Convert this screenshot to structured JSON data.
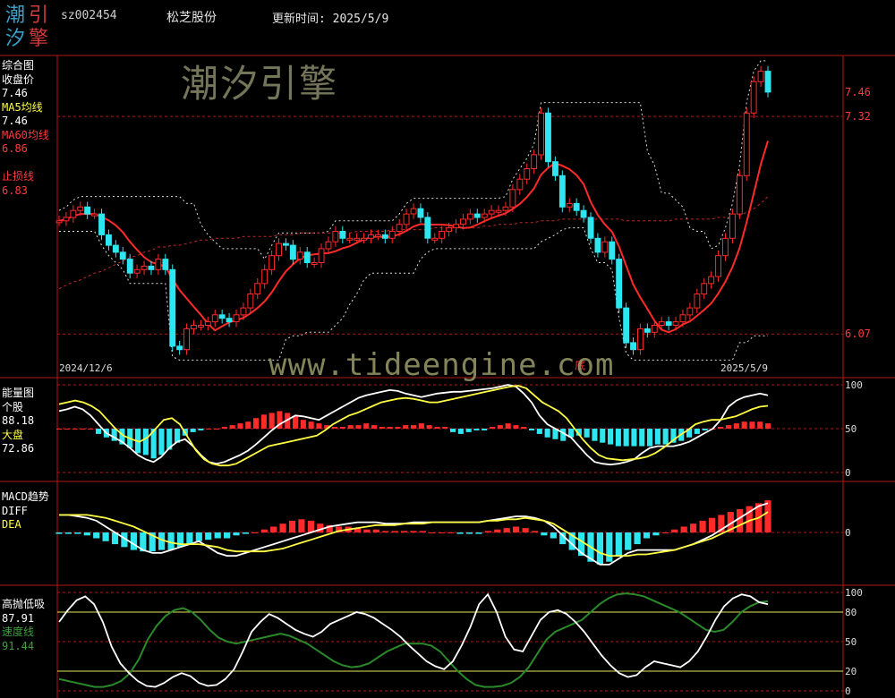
{
  "header": {
    "logo_chars": [
      "潮",
      "引",
      "汐",
      "擎"
    ],
    "code": "sz002454",
    "name": "松芝股份",
    "update": "更新时间: 2025/5/9"
  },
  "watermark": {
    "top": "潮汐引擎",
    "bottom": "www.tideengine.com"
  },
  "panels": {
    "main": {
      "labels": [
        {
          "text": "综合图",
          "color": "#ffffff"
        },
        {
          "text": "收盘价",
          "color": "#ffffff"
        },
        {
          "text": "7.46",
          "color": "#ffffff"
        },
        {
          "text": "MA5均线",
          "color": "#ffff44"
        },
        {
          "text": "7.46",
          "color": "#ffffff"
        },
        {
          "text": "MA60均线",
          "color": "#ff3b3b"
        },
        {
          "text": "6.86",
          "color": "#ff3b3b"
        },
        {
          "text": "",
          "color": "#ffffff"
        },
        {
          "text": "止损线",
          "color": "#ff3b3b"
        },
        {
          "text": "6.83",
          "color": "#ff3b3b"
        }
      ],
      "right_prices": [
        {
          "text": "7.46",
          "y": 7.46
        },
        {
          "text": "7.32",
          "y": 7.32
        },
        {
          "text": "6.07",
          "y": 6.07
        }
      ],
      "start_date": "2024/12/6",
      "end_date": "2025/5/9",
      "marker": "底"
    },
    "energy": {
      "labels": [
        {
          "text": "能量图",
          "color": "#ffffff"
        },
        {
          "text": "个股",
          "color": "#ffffff"
        },
        {
          "text": "88.18",
          "color": "#ffffff"
        },
        {
          "text": "大盘",
          "color": "#ffff44"
        },
        {
          "text": "72.86",
          "color": "#ffffff"
        }
      ],
      "axis": [
        "100",
        "50",
        "0"
      ]
    },
    "macd": {
      "labels": [
        {
          "text": "MACD趋势",
          "color": "#ffffff"
        },
        {
          "text": "DIFF",
          "color": "#ffffff"
        },
        {
          "text": "DEA",
          "color": "#ffff44"
        }
      ],
      "axis": [
        "0"
      ]
    },
    "osc": {
      "labels": [
        {
          "text": "高抛低吸",
          "color": "#ffffff"
        },
        {
          "text": "87.91",
          "color": "#ffffff"
        },
        {
          "text": "速度线",
          "color": "#3ca03c"
        },
        {
          "text": "91.44",
          "color": "#3ca03c"
        }
      ],
      "axis": [
        "100",
        "80",
        "50",
        "20",
        "0"
      ]
    }
  },
  "chart_data": [
    {
      "type": "candlestick",
      "ylim": [
        5.85,
        7.65
      ],
      "close": [
        6.72,
        6.74,
        6.78,
        6.8,
        6.76,
        6.76,
        6.64,
        6.58,
        6.54,
        6.5,
        6.42,
        6.44,
        6.46,
        6.44,
        6.5,
        6.44,
        6.0,
        5.98,
        6.1,
        6.12,
        6.12,
        6.14,
        6.18,
        6.16,
        6.14,
        6.18,
        6.22,
        6.3,
        6.36,
        6.44,
        6.52,
        6.59,
        6.58,
        6.5,
        6.54,
        6.48,
        6.48,
        6.56,
        6.6,
        6.66,
        6.62,
        6.62,
        6.62,
        6.62,
        6.64,
        6.64,
        6.62,
        6.66,
        6.7,
        6.76,
        6.79,
        6.74,
        6.62,
        6.62,
        6.66,
        6.68,
        6.7,
        6.73,
        6.76,
        6.74,
        6.76,
        6.78,
        6.78,
        6.8,
        6.9,
        6.96,
        7.02,
        7.1,
        7.34,
        7.06,
        6.98,
        6.8,
        6.82,
        6.78,
        6.74,
        6.62,
        6.54,
        6.6,
        6.5,
        6.22,
        6.02,
        5.98,
        6.1,
        6.08,
        6.12,
        6.14,
        6.12,
        6.14,
        6.18,
        6.22,
        6.3,
        6.36,
        6.4,
        6.52,
        6.62,
        6.76,
        6.98,
        7.34,
        7.52,
        7.58,
        7.46
      ],
      "ma60": [
        6.33,
        6.35,
        6.37,
        6.38,
        6.4,
        6.42,
        6.43,
        6.45,
        6.47,
        6.49,
        6.51,
        6.52,
        6.54,
        6.55,
        6.57,
        6.57,
        6.58,
        6.58,
        6.59,
        6.6,
        6.61,
        6.61,
        6.62,
        6.62,
        6.62,
        6.62,
        6.63,
        6.63,
        6.63,
        6.63,
        6.63,
        6.64,
        6.64,
        6.64,
        6.65,
        6.65,
        6.65,
        6.65,
        6.65,
        6.65,
        6.65,
        6.65,
        6.66,
        6.66,
        6.66,
        6.66,
        6.66,
        6.67,
        6.67,
        6.67,
        6.67,
        6.67,
        6.67,
        6.68,
        6.68,
        6.68,
        6.68,
        6.68,
        6.68,
        6.68,
        6.69,
        6.69,
        6.7,
        6.7,
        6.7,
        6.71,
        6.71,
        6.71,
        6.72,
        6.72,
        6.72,
        6.73,
        6.73,
        6.73,
        6.73,
        6.73,
        6.73,
        6.73,
        6.73,
        6.73,
        6.72,
        6.72,
        6.72,
        6.72,
        6.72,
        6.72,
        6.72,
        6.73,
        6.73,
        6.73,
        6.73,
        6.73,
        6.73,
        6.74,
        6.74,
        6.74,
        6.75,
        6.77,
        6.79,
        6.82,
        6.86
      ]
    },
    {
      "type": "line",
      "ylim": [
        0,
        100
      ],
      "series": [
        {
          "name": "个股",
          "values": [
            70,
            72,
            75,
            72,
            65,
            55,
            45,
            40,
            35,
            28,
            20,
            15,
            12,
            18,
            28,
            35,
            38,
            30,
            20,
            12,
            10,
            12,
            16,
            20,
            25,
            32,
            40,
            48,
            55,
            60,
            65,
            64,
            62,
            60,
            65,
            70,
            75,
            80,
            85,
            88,
            90,
            92,
            94,
            93,
            90,
            88,
            86,
            88,
            90,
            91,
            92,
            92,
            93,
            94,
            95,
            96,
            98,
            100,
            98,
            90,
            80,
            65,
            55,
            50,
            45,
            40,
            30,
            20,
            12,
            10,
            9,
            10,
            12,
            15,
            22,
            28,
            30,
            30,
            30,
            32,
            35,
            40,
            45,
            50,
            60,
            75,
            82,
            86,
            88,
            90,
            88
          ]
        },
        {
          "name": "大盘",
          "values": [
            78,
            80,
            82,
            80,
            76,
            70,
            60,
            50,
            42,
            38,
            35,
            40,
            50,
            60,
            62,
            55,
            40,
            25,
            15,
            10,
            8,
            8,
            10,
            15,
            20,
            25,
            30,
            32,
            34,
            36,
            38,
            40,
            42,
            48,
            55,
            60,
            65,
            68,
            72,
            76,
            80,
            82,
            84,
            85,
            84,
            82,
            80,
            80,
            82,
            84,
            86,
            88,
            90,
            92,
            94,
            96,
            98,
            99,
            96,
            88,
            80,
            75,
            70,
            62,
            50,
            38,
            28,
            20,
            16,
            15,
            14,
            15,
            16,
            18,
            22,
            28,
            35,
            42,
            48,
            55,
            58,
            60,
            60,
            62,
            64,
            68,
            72,
            75,
            76
          ]
        }
      ],
      "bars": [
        0,
        0,
        0,
        0,
        0,
        -6,
        -10,
        -14,
        -18,
        -22,
        -28,
        -30,
        -34,
        -30,
        -24,
        -16,
        -8,
        -4,
        -2,
        0,
        0,
        2,
        4,
        6,
        8,
        12,
        16,
        18,
        20,
        18,
        14,
        10,
        8,
        6,
        4,
        2,
        2,
        4,
        4,
        6,
        4,
        2,
        2,
        2,
        4,
        4,
        6,
        4,
        2,
        2,
        -4,
        -6,
        -4,
        -2,
        -2,
        2,
        4,
        6,
        4,
        2,
        -2,
        -6,
        -10,
        -12,
        -14,
        -10,
        -8,
        -10,
        -14,
        -16,
        -18,
        -20,
        -20,
        -20,
        -20,
        -20,
        -18,
        -18,
        -16,
        -14,
        -10,
        -6,
        -2,
        0,
        2,
        4,
        6,
        8,
        8,
        8,
        6
      ]
    },
    {
      "type": "line",
      "ylim": [
        -0.3,
        0.3
      ],
      "series": [
        {
          "name": "DIFF",
          "values": [
            0.12,
            0.12,
            0.11,
            0.1,
            0.08,
            0.04,
            0.0,
            -0.04,
            -0.08,
            -0.12,
            -0.14,
            -0.14,
            -0.12,
            -0.1,
            -0.08,
            -0.06,
            -0.1,
            -0.14,
            -0.16,
            -0.16,
            -0.14,
            -0.12,
            -0.1,
            -0.08,
            -0.06,
            -0.04,
            -0.02,
            0.0,
            0.02,
            0.04,
            0.05,
            0.06,
            0.07,
            0.07,
            0.07,
            0.06,
            0.06,
            0.06,
            0.07,
            0.07,
            0.07,
            0.07,
            0.07,
            0.07,
            0.07,
            0.07,
            0.08,
            0.09,
            0.1,
            0.11,
            0.11,
            0.1,
            0.08,
            0.04,
            -0.02,
            -0.08,
            -0.14,
            -0.18,
            -0.22,
            -0.22,
            -0.18,
            -0.14,
            -0.12,
            -0.12,
            -0.12,
            -0.12,
            -0.12,
            -0.1,
            -0.08,
            -0.05,
            -0.02,
            0.02,
            0.06,
            0.1,
            0.14,
            0.18,
            0.2
          ]
        },
        {
          "name": "DEA",
          "values": [
            0.12,
            0.12,
            0.12,
            0.12,
            0.11,
            0.1,
            0.08,
            0.06,
            0.04,
            0.01,
            -0.02,
            -0.05,
            -0.07,
            -0.08,
            -0.08,
            -0.08,
            -0.09,
            -0.1,
            -0.12,
            -0.13,
            -0.13,
            -0.13,
            -0.13,
            -0.12,
            -0.11,
            -0.09,
            -0.07,
            -0.05,
            -0.03,
            -0.01,
            0.01,
            0.02,
            0.03,
            0.04,
            0.05,
            0.05,
            0.05,
            0.06,
            0.06,
            0.06,
            0.07,
            0.07,
            0.07,
            0.07,
            0.07,
            0.07,
            0.08,
            0.08,
            0.09,
            0.09,
            0.1,
            0.09,
            0.08,
            0.06,
            0.02,
            -0.02,
            -0.06,
            -0.1,
            -0.14,
            -0.16,
            -0.16,
            -0.16,
            -0.15,
            -0.15,
            -0.14,
            -0.13,
            -0.12,
            -0.1,
            -0.08,
            -0.06,
            -0.04,
            -0.01,
            0.02,
            0.05,
            0.08,
            0.1,
            0.14
          ]
        }
      ],
      "bars": [
        -0.01,
        -0.01,
        -0.01,
        -0.02,
        -0.04,
        -0.06,
        -0.08,
        -0.1,
        -0.12,
        -0.13,
        -0.13,
        -0.12,
        -0.12,
        -0.1,
        -0.08,
        -0.06,
        -0.05,
        -0.04,
        -0.04,
        -0.02,
        -0.01,
        0.0,
        0.02,
        0.04,
        0.06,
        0.08,
        0.09,
        0.08,
        0.06,
        0.05,
        0.04,
        0.04,
        0.03,
        0.02,
        0.02,
        0.01,
        0.01,
        0.01,
        0.01,
        0.01,
        0.0,
        0.0,
        0.0,
        -0.01,
        -0.01,
        -0.01,
        0.01,
        0.02,
        0.03,
        0.04,
        0.03,
        0.01,
        -0.02,
        -0.04,
        -0.08,
        -0.12,
        -0.16,
        -0.2,
        -0.22,
        -0.2,
        -0.16,
        -0.12,
        -0.08,
        -0.04,
        -0.02,
        0.0,
        0.02,
        0.04,
        0.06,
        0.08,
        0.1,
        0.12,
        0.14,
        0.16,
        0.18,
        0.2,
        0.22
      ]
    },
    {
      "type": "line",
      "ylim": [
        0,
        100
      ],
      "series": [
        {
          "name": "高抛低吸",
          "values": [
            70,
            82,
            92,
            96,
            88,
            70,
            45,
            28,
            18,
            10,
            5,
            4,
            8,
            14,
            18,
            15,
            8,
            5,
            6,
            12,
            22,
            40,
            60,
            70,
            78,
            74,
            68,
            62,
            58,
            55,
            60,
            68,
            72,
            76,
            80,
            78,
            74,
            68,
            62,
            55,
            46,
            38,
            30,
            25,
            22,
            30,
            46,
            65,
            88,
            98,
            80,
            55,
            42,
            40,
            56,
            72,
            80,
            82,
            78,
            70,
            60,
            48,
            36,
            26,
            18,
            14,
            16,
            24,
            30,
            28,
            26,
            24,
            30,
            40,
            55,
            72,
            86,
            94,
            98,
            96,
            90,
            88
          ]
        },
        {
          "name": "速度线",
          "values": [
            12,
            10,
            8,
            6,
            4,
            4,
            6,
            10,
            18,
            32,
            52,
            66,
            76,
            82,
            84,
            80,
            72,
            62,
            54,
            50,
            48,
            50,
            52,
            54,
            56,
            58,
            56,
            52,
            48,
            42,
            36,
            30,
            26,
            24,
            25,
            28,
            34,
            40,
            44,
            48,
            48,
            48,
            46,
            40,
            30,
            20,
            12,
            6,
            4,
            4,
            5,
            8,
            14,
            24,
            38,
            52,
            60,
            64,
            68,
            72,
            80,
            88,
            94,
            98,
            99,
            98,
            96,
            92,
            88,
            84,
            80,
            74,
            68,
            62,
            60,
            62,
            70,
            80,
            86,
            90,
            91
          ]
        }
      ]
    }
  ]
}
